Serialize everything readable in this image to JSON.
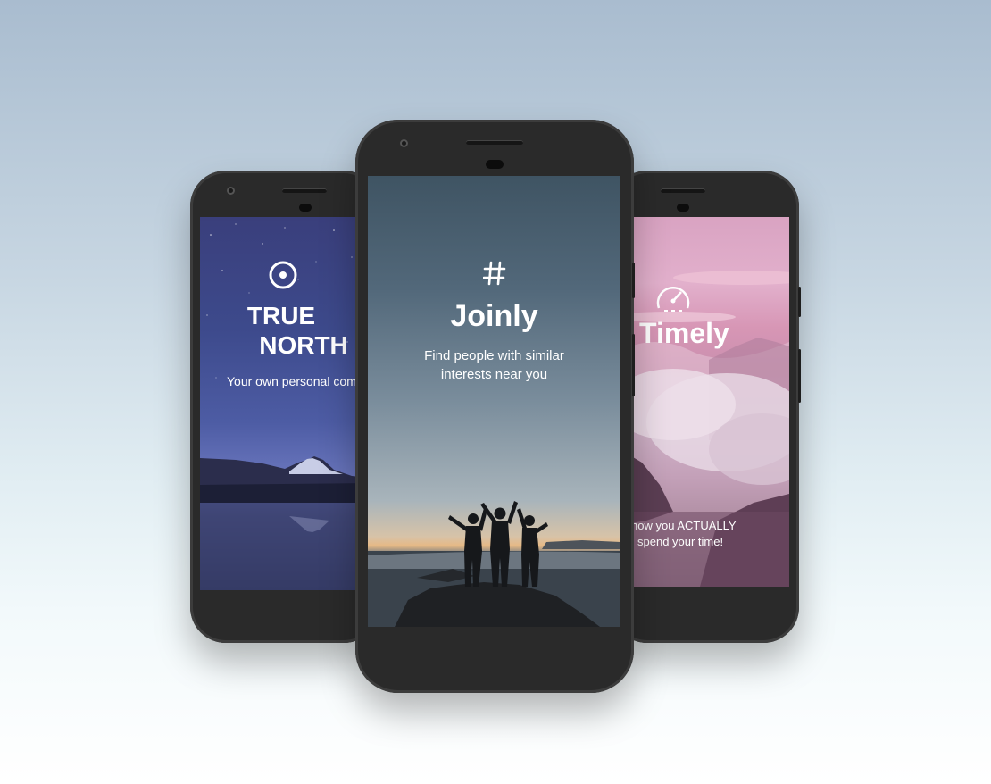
{
  "phones": {
    "left": {
      "app_name_line1": "TRUE",
      "app_name_line2": "NORTH",
      "tagline": "Your own personal com",
      "icon": "target-icon"
    },
    "center": {
      "app_name": "Joinly",
      "tagline_line1": "Find people with similar",
      "tagline_line2": "interests near you",
      "icon": "hashtag-icon"
    },
    "right": {
      "app_name": "Timely",
      "tagline_line1": "w how you ACTUALLY",
      "tagline_line2": "spend your time!",
      "icon": "stopwatch-icon"
    }
  },
  "colors": {
    "phone_body": "#2a2a2a",
    "left_screen": "#3d4a8c",
    "center_screen": "#52687a",
    "right_screen": "#d796b5"
  }
}
